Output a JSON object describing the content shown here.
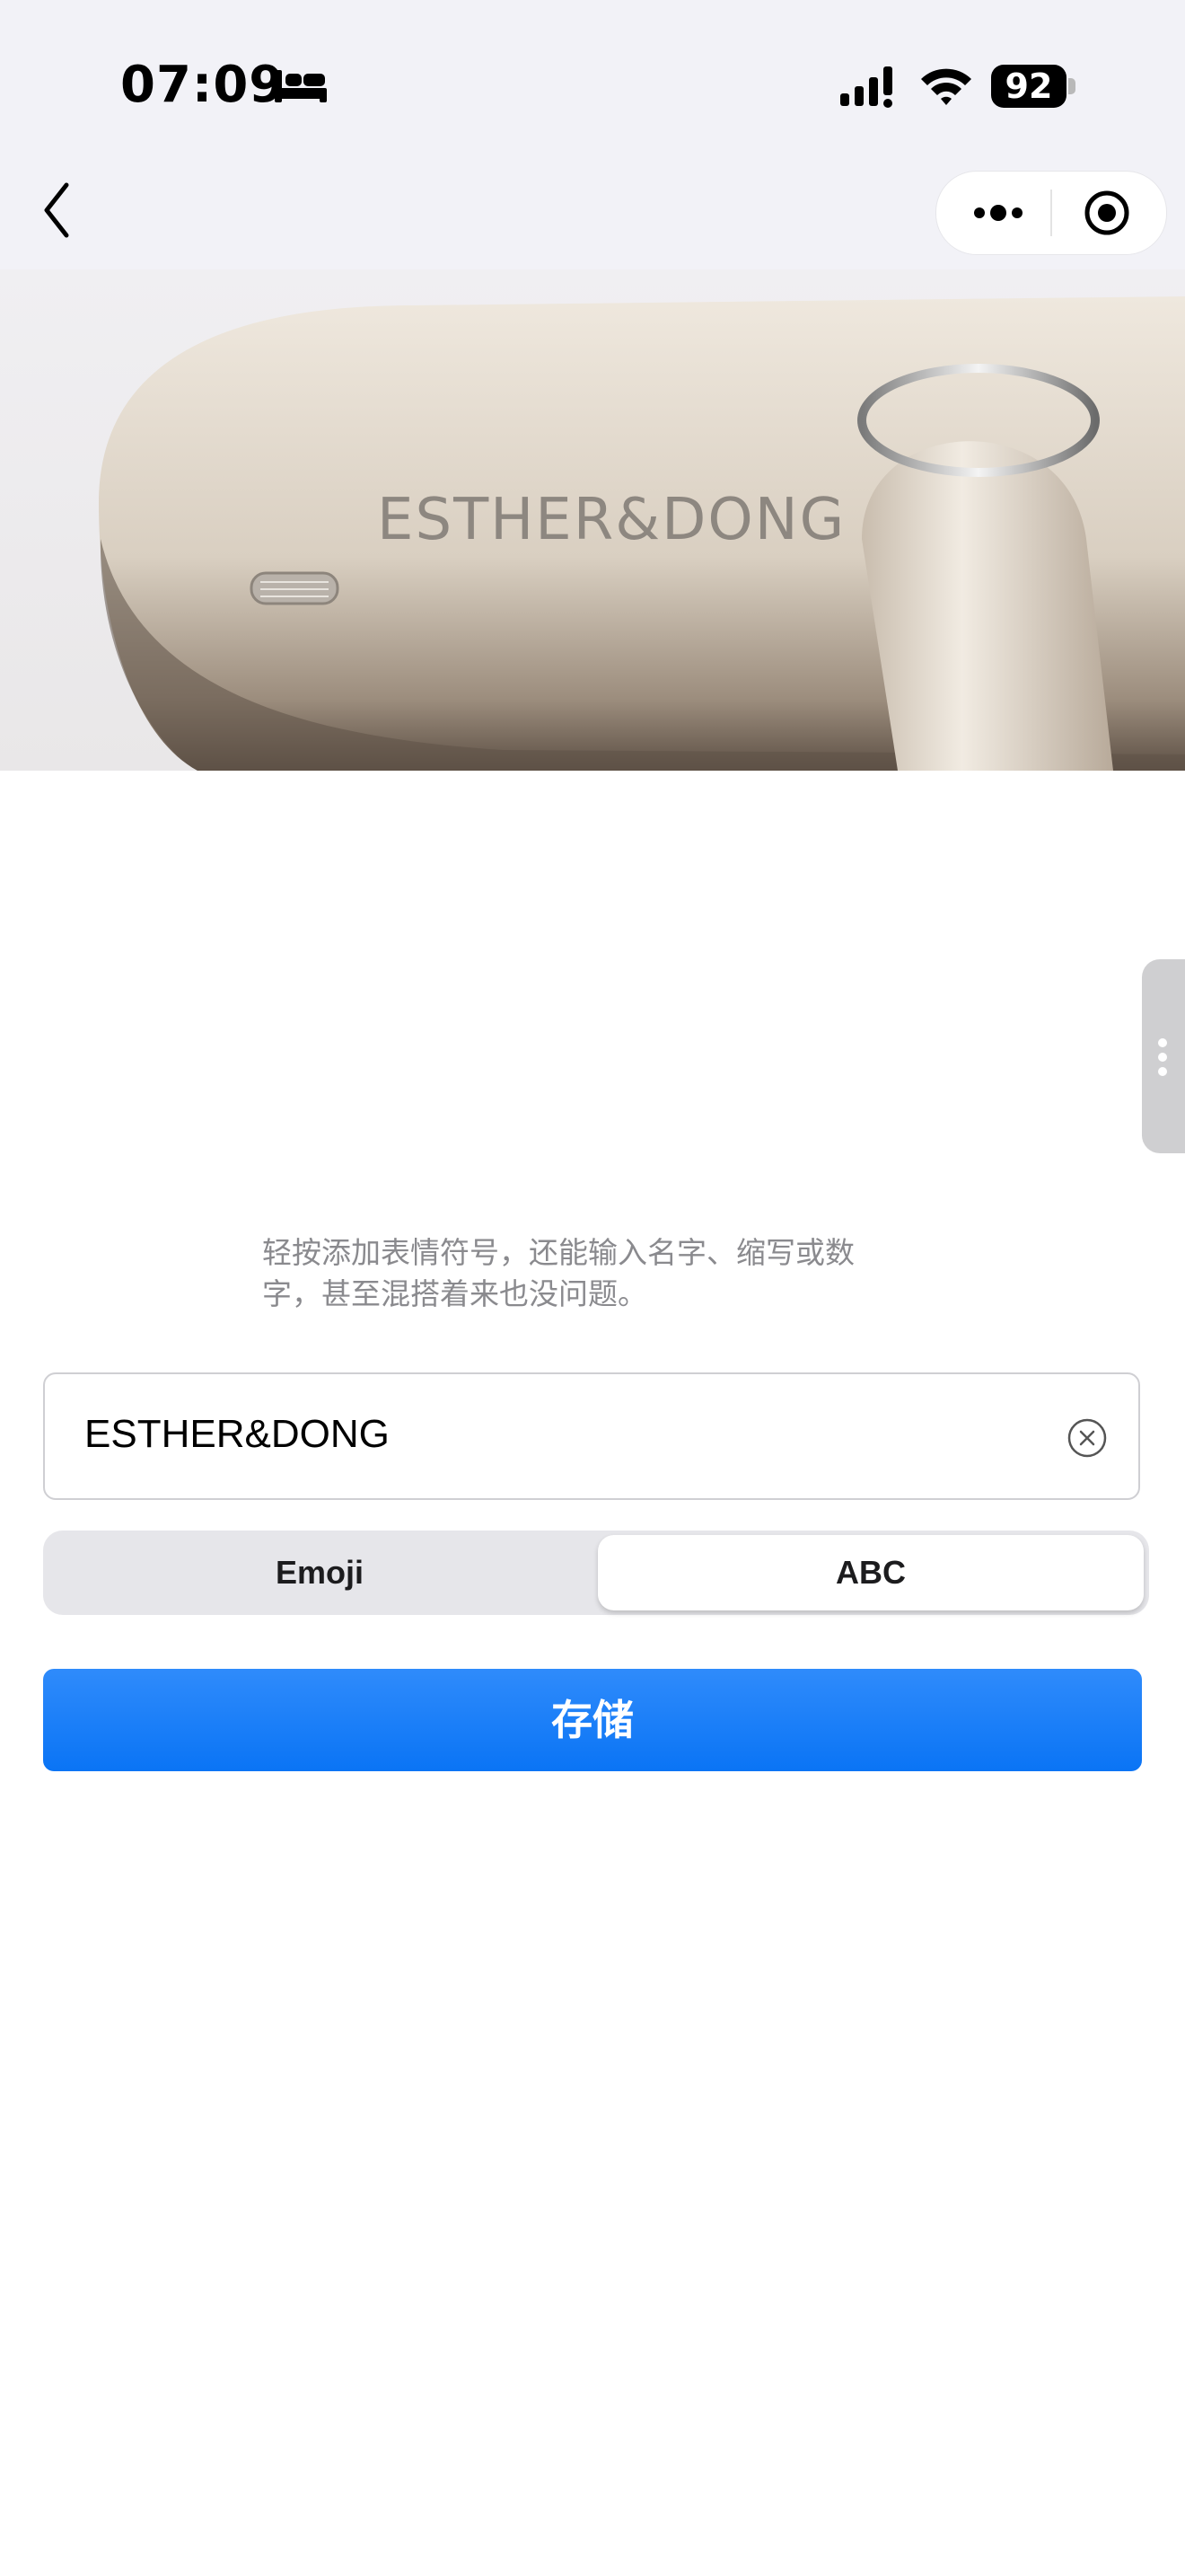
{
  "status_bar": {
    "time": "07:09",
    "battery": "92",
    "icons": [
      "bed-icon",
      "cellular-signal-icon",
      "wifi-icon",
      "battery-icon"
    ]
  },
  "nav": {
    "icons": [
      "back-chevron-icon",
      "more-dots-icon",
      "record-target-icon"
    ]
  },
  "hero": {
    "engraving": "ESTHER&DONG",
    "colors": {
      "case_light": "#e9e2d7",
      "case_shadow": "#7d6e60",
      "text": "#8d8780"
    }
  },
  "content": {
    "hint": "轻按添加表情符号，还能输入名字、缩写或数字，甚至混搭着来也没问题。",
    "input_value": "ESTHER&DONG",
    "segments": [
      {
        "label": "Emoji",
        "selected": false
      },
      {
        "label": "ABC",
        "selected": true
      }
    ],
    "save_label": "存储"
  },
  "colors": {
    "accent": "#0a74f5",
    "background": "#ffffff",
    "header_background": "#f2f2f7"
  }
}
